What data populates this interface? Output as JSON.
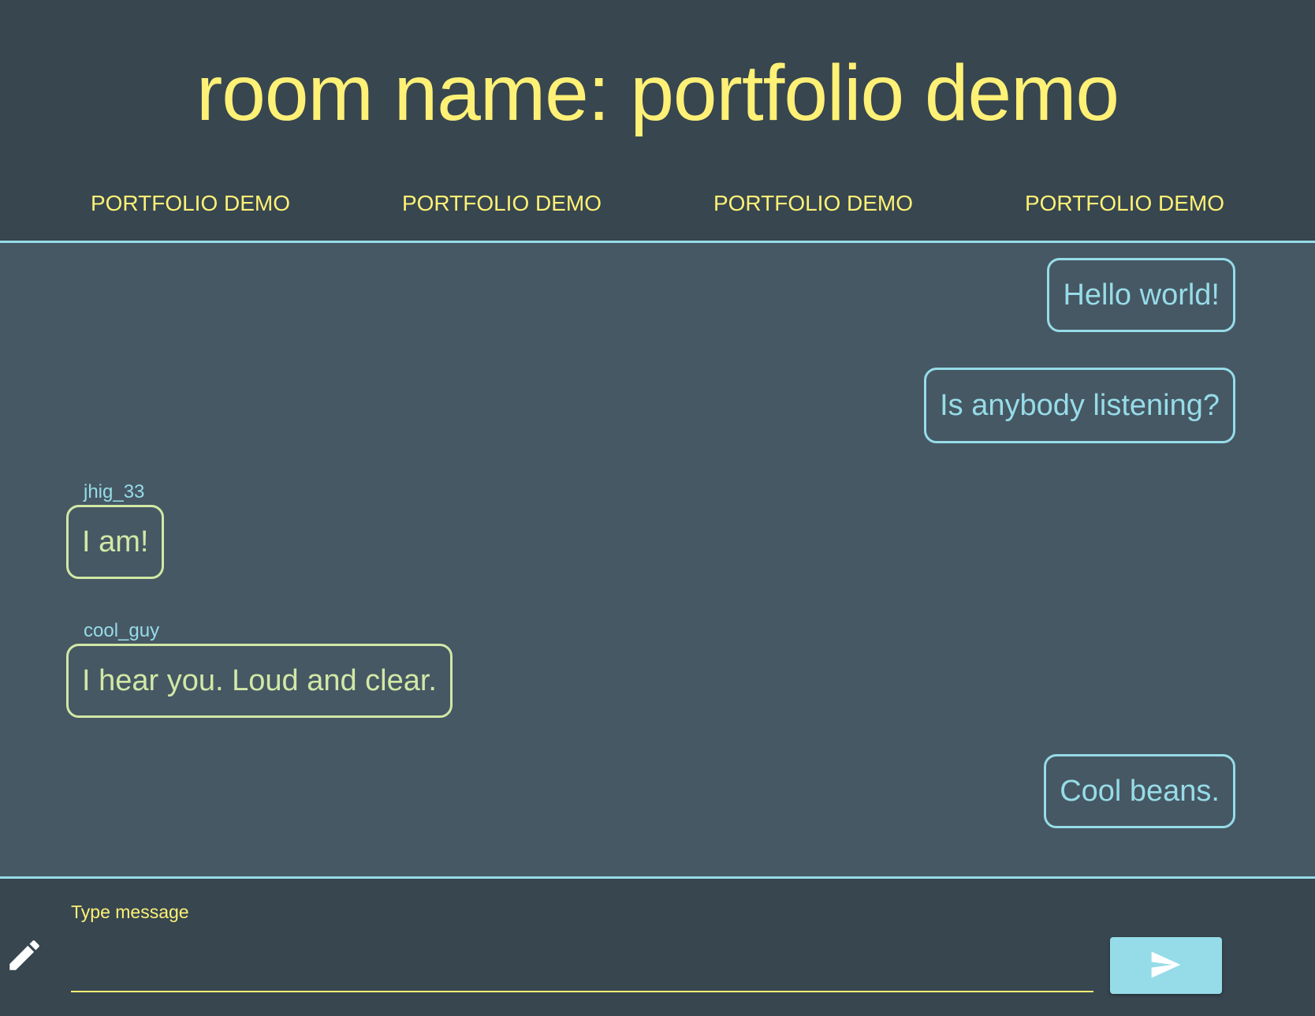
{
  "header": {
    "title": "room name: portfolio demo",
    "tabs": [
      {
        "label": "PORTFOLIO DEMO"
      },
      {
        "label": "PORTFOLIO DEMO"
      },
      {
        "label": "PORTFOLIO DEMO"
      },
      {
        "label": "PORTFOLIO DEMO"
      }
    ]
  },
  "messages": [
    {
      "text": "Hello world!",
      "own": true,
      "sender": ""
    },
    {
      "text": "Is anybody listening?",
      "own": true,
      "sender": ""
    },
    {
      "text": "I am!",
      "own": false,
      "sender": "jhig_33"
    },
    {
      "text": "I hear you. Loud and clear.",
      "own": false,
      "sender": "cool_guy"
    },
    {
      "text": "Cool beans.",
      "own": true,
      "sender": ""
    }
  ],
  "composer": {
    "label": "Type message",
    "value": "",
    "placeholder": "",
    "pencil_icon": "pencil-icon",
    "send_icon": "send-icon"
  },
  "colors": {
    "background_dark": "#37464f",
    "background_messages": "#465864",
    "accent_yellow": "#fff176",
    "accent_cyan": "#96dce8",
    "accent_green": "#d2e8a6"
  }
}
